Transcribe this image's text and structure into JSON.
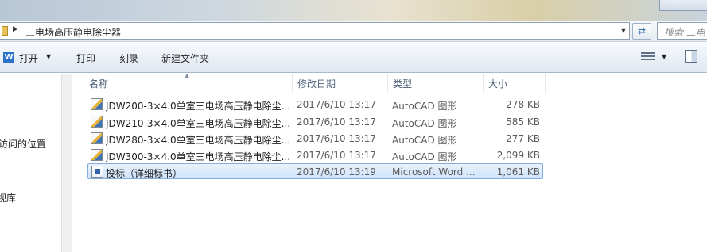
{
  "address": {
    "breadcrumb": "三电场高压静电除尘器",
    "search_placeholder": "搜索 三电"
  },
  "toolbar": {
    "open_label": "打开",
    "print_label": "打印",
    "burn_label": "刻录",
    "new_folder_label": "新建文件夹"
  },
  "nav": {
    "items": [
      "访问的位置",
      "视库"
    ]
  },
  "columns": {
    "name": "名称",
    "modified": "修改日期",
    "type": "类型",
    "size": "大小"
  },
  "files": [
    {
      "name": "JDW200-3×4.0单室三电场高压静电除尘...",
      "modified": "2017/6/10 13:17",
      "type": "AutoCAD 图形",
      "size": "278 KB",
      "icon": "autocad-icon"
    },
    {
      "name": "JDW210-3×4.0单室三电场高压静电除尘...",
      "modified": "2017/6/10 13:17",
      "type": "AutoCAD 图形",
      "size": "585 KB",
      "icon": "autocad-icon"
    },
    {
      "name": "JDW280-3×4.0单室三电场高压静电除尘...",
      "modified": "2017/6/10 13:17",
      "type": "AutoCAD 图形",
      "size": "277 KB",
      "icon": "autocad-icon"
    },
    {
      "name": "JDW300-3×4.0单室三电场高压静电除尘...",
      "modified": "2017/6/10 13:17",
      "type": "AutoCAD 图形",
      "size": "2,099 KB",
      "icon": "autocad-icon"
    },
    {
      "name": "投标（详细标书）",
      "modified": "2017/6/10 13:19",
      "type": "Microsoft Word ...",
      "size": "1,061 KB",
      "icon": "word-doc-icon",
      "selected": true
    }
  ],
  "colors": {
    "selection": "#cfe3fb",
    "selection_border": "#84acdd",
    "header_text": "#4c607a"
  }
}
